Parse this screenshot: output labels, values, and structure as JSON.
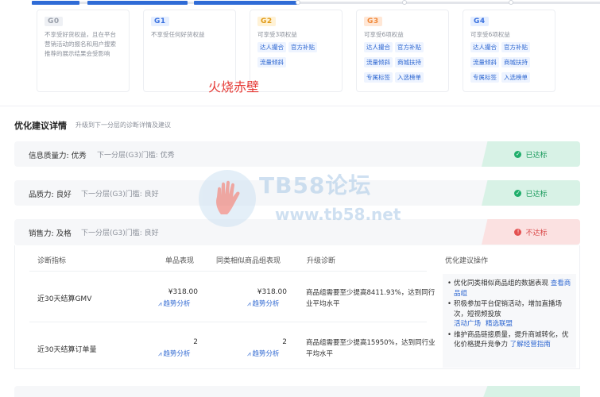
{
  "tiers": [
    {
      "level": "G0",
      "desc": "不享受好货权益，且在平台营销活动的报名和用户搜索推荐的展示结果会受影响",
      "tags": []
    },
    {
      "level": "G1",
      "desc": "不享受任何好货权益",
      "tags": []
    },
    {
      "level": "G2",
      "desc": "可享受3项权益",
      "tags": [
        "达人撮合",
        "官方补贴",
        "流量倾斜"
      ]
    },
    {
      "level": "G3",
      "desc": "可享受6项权益",
      "tags": [
        "达人撮合",
        "官方补贴",
        "流量倾斜",
        "商城扶持",
        "专属标签",
        "入选榜单"
      ]
    },
    {
      "level": "G4",
      "desc": "可享受6项权益",
      "tags": [
        "达人撮合",
        "官方补贴",
        "流量倾斜",
        "商城扶持",
        "专属标签",
        "入选榜单"
      ]
    }
  ],
  "overlay_text": "火烧赤壁",
  "section": {
    "title": "优化建议详情",
    "subtitle": "升级到下一分层的诊断详情及建议"
  },
  "rows": [
    {
      "name": "信息质量力: 优秀",
      "next": "下一分层(G3)门槛: 优秀",
      "status": "已达标",
      "status_icon": "✓"
    },
    {
      "name": "品质力: 良好",
      "next": "下一分层(G3)门槛: 良好",
      "status": "已达标",
      "status_icon": "✓"
    },
    {
      "name": "销售力: 及格",
      "next": "下一分层(G3)门槛: 良好",
      "status": "不达标",
      "status_icon": "!"
    }
  ],
  "table": {
    "headers": [
      "诊断指标",
      "单品表现",
      "同类相似商品组表现",
      "升级诊断",
      "优化建议操作"
    ],
    "trend_label": "趋势分析",
    "rows": [
      {
        "metric": "近30天结算GMV",
        "single": "¥318.00",
        "group": "¥318.00",
        "diagnosis": "商品组需要至少提高8411.93%，达到同行业平均水平"
      },
      {
        "metric": "近30天结算订单量",
        "single": "2",
        "group": "2",
        "diagnosis": "商品组需要至少提高15950%，达到同行业平均水平"
      }
    ],
    "advice": [
      {
        "text": "优化同类相似商品组的数据表现",
        "links": [
          "查看商品组"
        ]
      },
      {
        "text": "积极参加平台促销活动，增加直播场次，短视频投放",
        "links": [
          "活动广场",
          "精选联盟"
        ]
      },
      {
        "text": "维护商品链接质量，提升商城转化，优化价格提升竞争力",
        "links": [
          "了解经营指南"
        ]
      }
    ]
  },
  "watermark": {
    "title": "TB58论坛",
    "url": "www.tb58.net"
  },
  "progress": 0.47
}
